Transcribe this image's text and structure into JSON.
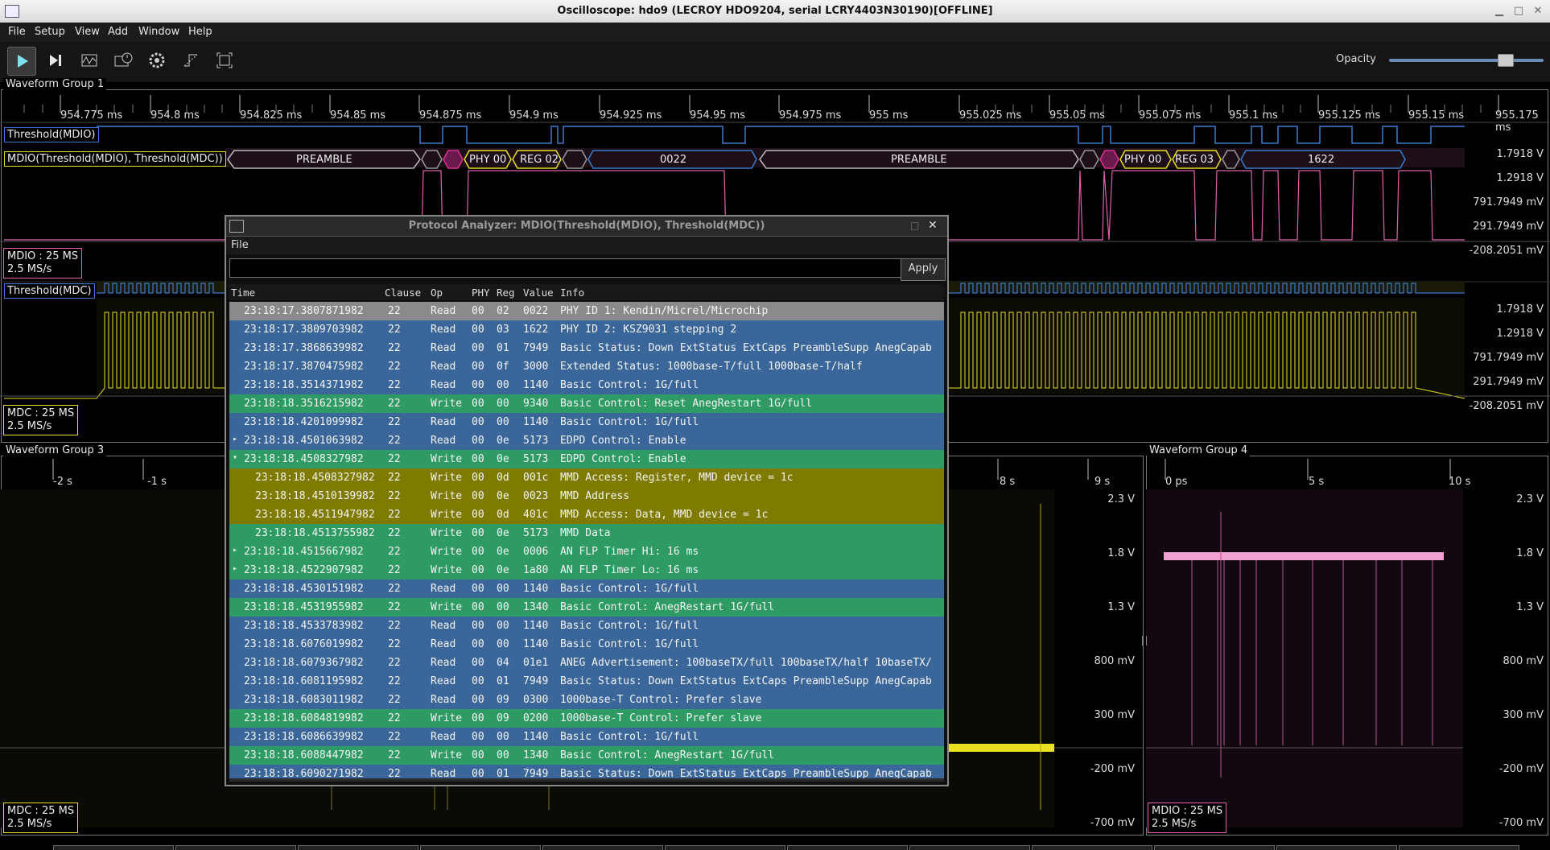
{
  "window": {
    "title": "Oscilloscope: hdo9 (LECROY HDO9204, serial LCRY4403N30190)[OFFLINE]"
  },
  "menu": [
    "File",
    "Setup",
    "View",
    "Add",
    "Window",
    "Help"
  ],
  "toolbar": {
    "buttons": [
      "play-icon",
      "step-icon",
      "waveform-icon",
      "history-icon",
      "settings-icon",
      "trigger-icon",
      "fullscreen-icon"
    ],
    "opacity_label": "Opacity",
    "opacity_value": 0.75
  },
  "group1": {
    "label": "Waveform Group 1",
    "ticks": [
      "954.775 ms",
      "954.8 ms",
      "954.825 ms",
      "954.85 ms",
      "954.875 ms",
      "954.9 ms",
      "954.925 ms",
      "954.95 ms",
      "954.975 ms",
      "955 ms",
      "955.025 ms",
      "955.05 ms",
      "955.075 ms",
      "955.1 ms",
      "955.125 ms",
      "955.15 ms",
      "955.175 ms"
    ],
    "threshold_mdio_label": "Threshold(MDIO)",
    "decode_label": "MDIO(Threshold(MDIO), Threshold(MDC))",
    "decode_segments": [
      "PREAMBLE",
      "PHY 00",
      "REG 02",
      "0022",
      "PREAMBLE",
      "PHY 00",
      "REG 03",
      "1622"
    ],
    "mdio_badge": [
      "MDIO : 25 MS",
      "2.5 MS/s"
    ],
    "volt_labels_top": [
      "1.7918 V",
      "1.2918 V",
      "791.7949 mV",
      "291.7949 mV",
      "-208.2051 mV"
    ],
    "threshold_mdc_label": "Threshold(MDC)",
    "mdc_badge": [
      "MDC : 25 MS",
      "2.5 MS/s"
    ],
    "volt_labels_mid": [
      "1.7918 V",
      "1.2918 V",
      "791.7949 mV",
      "291.7949 mV",
      "-208.2051 mV"
    ]
  },
  "group3": {
    "label": "Waveform Group 3",
    "ticks": [
      "-2 s",
      "-1 s",
      "8 s",
      "9 s"
    ],
    "volt_labels": [
      "2.3 V",
      "1.8 V",
      "1.3 V",
      "800 mV",
      "300 mV",
      "-200 mV",
      "-700 mV"
    ],
    "badge": [
      "MDC : 25 MS",
      "2.5 MS/s"
    ]
  },
  "group4": {
    "label": "Waveform Group 4",
    "ticks": [
      "0 ps",
      "5 s",
      "10 s"
    ],
    "volt_labels": [
      "2.3 V",
      "1.8 V",
      "1.3 V",
      "800 mV",
      "300 mV",
      "-200 mV",
      "-700 mV"
    ],
    "badge": [
      "MDIO : 25 MS",
      "2.5 MS/s"
    ]
  },
  "analyzer": {
    "title": "Protocol Analyzer: MDIO(Threshold(MDIO), Threshold(MDC))",
    "menu_file": "File",
    "filter_value": "",
    "apply_label": "Apply",
    "columns": [
      "Time",
      "Clause",
      "Op",
      "PHY",
      "Reg",
      "Value",
      "Info"
    ],
    "rows": [
      {
        "kind": "sel",
        "exp": "",
        "time": "23:18:17.3807871982",
        "clause": "22",
        "op": "Read",
        "phy": "00",
        "reg": "02",
        "val": "0022",
        "info": "PHY ID 1: Kendin/Micrel/Microchip"
      },
      {
        "kind": "read",
        "exp": "",
        "time": "23:18:17.3809703982",
        "clause": "22",
        "op": "Read",
        "phy": "00",
        "reg": "03",
        "val": "1622",
        "info": "PHY ID 2: KSZ9031 stepping 2"
      },
      {
        "kind": "read",
        "exp": "",
        "time": "23:18:17.3868639982",
        "clause": "22",
        "op": "Read",
        "phy": "00",
        "reg": "01",
        "val": "7949",
        "info": "Basic Status: Down ExtStatus ExtCaps PreambleSupp AnegCapab"
      },
      {
        "kind": "read",
        "exp": "",
        "time": "23:18:17.3870475982",
        "clause": "22",
        "op": "Read",
        "phy": "00",
        "reg": "0f",
        "val": "3000",
        "info": "Extended Status: 1000base-T/full 1000base-T/half"
      },
      {
        "kind": "read",
        "exp": "",
        "time": "23:18:18.3514371982",
        "clause": "22",
        "op": "Read",
        "phy": "00",
        "reg": "00",
        "val": "1140",
        "info": "Basic Control: 1G/full"
      },
      {
        "kind": "write",
        "exp": "",
        "time": "23:18:18.3516215982",
        "clause": "22",
        "op": "Write",
        "phy": "00",
        "reg": "00",
        "val": "9340",
        "info": "Basic Control: Reset AnegRestart 1G/full"
      },
      {
        "kind": "read",
        "exp": "",
        "time": "23:18:18.4201099982",
        "clause": "22",
        "op": "Read",
        "phy": "00",
        "reg": "00",
        "val": "1140",
        "info": "Basic Control: 1G/full"
      },
      {
        "kind": "read",
        "exp": "▸",
        "time": "23:18:18.4501063982",
        "clause": "22",
        "op": "Read",
        "phy": "00",
        "reg": "0e",
        "val": "5173",
        "info": "EDPD Control: Enable"
      },
      {
        "kind": "write",
        "exp": "▾",
        "time": "23:18:18.4508327982",
        "clause": "22",
        "op": "Write",
        "phy": "00",
        "reg": "0e",
        "val": "5173",
        "info": "EDPD Control: Enable"
      },
      {
        "kind": "sub",
        "exp": "",
        "time": "23:18:18.4508327982",
        "clause": "22",
        "op": "Write",
        "phy": "00",
        "reg": "0d",
        "val": "001c",
        "info": "MMD Access: Register, MMD device = 1c"
      },
      {
        "kind": "sub",
        "exp": "",
        "time": "23:18:18.4510139982",
        "clause": "22",
        "op": "Write",
        "phy": "00",
        "reg": "0e",
        "val": "0023",
        "info": "MMD Address"
      },
      {
        "kind": "sub",
        "exp": "",
        "time": "23:18:18.4511947982",
        "clause": "22",
        "op": "Write",
        "phy": "00",
        "reg": "0d",
        "val": "401c",
        "info": "MMD Access: Data, MMD device = 1c"
      },
      {
        "kind": "subw",
        "exp": "",
        "time": "23:18:18.4513755982",
        "clause": "22",
        "op": "Write",
        "phy": "00",
        "reg": "0e",
        "val": "5173",
        "info": "MMD Data"
      },
      {
        "kind": "write",
        "exp": "▸",
        "time": "23:18:18.4515667982",
        "clause": "22",
        "op": "Write",
        "phy": "00",
        "reg": "0e",
        "val": "0006",
        "info": "AN FLP Timer Hi: 16 ms"
      },
      {
        "kind": "write",
        "exp": "▸",
        "time": "23:18:18.4522907982",
        "clause": "22",
        "op": "Write",
        "phy": "00",
        "reg": "0e",
        "val": "1a80",
        "info": "AN FLP Timer Lo: 16 ms"
      },
      {
        "kind": "read",
        "exp": "",
        "time": "23:18:18.4530151982",
        "clause": "22",
        "op": "Read",
        "phy": "00",
        "reg": "00",
        "val": "1140",
        "info": "Basic Control: 1G/full"
      },
      {
        "kind": "write",
        "exp": "",
        "time": "23:18:18.4531955982",
        "clause": "22",
        "op": "Write",
        "phy": "00",
        "reg": "00",
        "val": "1340",
        "info": "Basic Control: AnegRestart 1G/full"
      },
      {
        "kind": "read",
        "exp": "",
        "time": "23:18:18.4533783982",
        "clause": "22",
        "op": "Read",
        "phy": "00",
        "reg": "00",
        "val": "1140",
        "info": "Basic Control: 1G/full"
      },
      {
        "kind": "read",
        "exp": "",
        "time": "23:18:18.6076019982",
        "clause": "22",
        "op": "Read",
        "phy": "00",
        "reg": "00",
        "val": "1140",
        "info": "Basic Control: 1G/full"
      },
      {
        "kind": "read",
        "exp": "",
        "time": "23:18:18.6079367982",
        "clause": "22",
        "op": "Read",
        "phy": "00",
        "reg": "04",
        "val": "01e1",
        "info": "ANEG Advertisement: 100baseTX/full 100baseTX/half 10baseTX/"
      },
      {
        "kind": "read",
        "exp": "",
        "time": "23:18:18.6081195982",
        "clause": "22",
        "op": "Read",
        "phy": "00",
        "reg": "01",
        "val": "7949",
        "info": "Basic Status: Down ExtStatus ExtCaps PreambleSupp AnegCapab"
      },
      {
        "kind": "read",
        "exp": "",
        "time": "23:18:18.6083011982",
        "clause": "22",
        "op": "Read",
        "phy": "00",
        "reg": "09",
        "val": "0300",
        "info": "1000base-T Control: Prefer slave"
      },
      {
        "kind": "write",
        "exp": "",
        "time": "23:18:18.6084819982",
        "clause": "22",
        "op": "Write",
        "phy": "00",
        "reg": "09",
        "val": "0200",
        "info": "1000base-T Control: Prefer slave"
      },
      {
        "kind": "read",
        "exp": "",
        "time": "23:18:18.6086639982",
        "clause": "22",
        "op": "Read",
        "phy": "00",
        "reg": "00",
        "val": "1140",
        "info": "Basic Control: 1G/full"
      },
      {
        "kind": "write",
        "exp": "",
        "time": "23:18:18.6088447982",
        "clause": "22",
        "op": "Write",
        "phy": "00",
        "reg": "00",
        "val": "1340",
        "info": "Basic Control: AnegRestart 1G/full"
      },
      {
        "kind": "read",
        "exp": "",
        "time": "23:18:18.6090271982",
        "clause": "22",
        "op": "Read",
        "phy": "00",
        "reg": "01",
        "val": "7949",
        "info": "Basic Status: Down ExtStatus ExtCaps PreambleSupp AnegCapab"
      }
    ]
  },
  "colors": {
    "mdio_trace": "#e060b0",
    "mdc_trace": "#e8e020",
    "threshold_trace": "#3a7ad0",
    "read_row": "#3a6699",
    "write_row": "#2e9a64",
    "mmd_row": "#7f7a00"
  }
}
